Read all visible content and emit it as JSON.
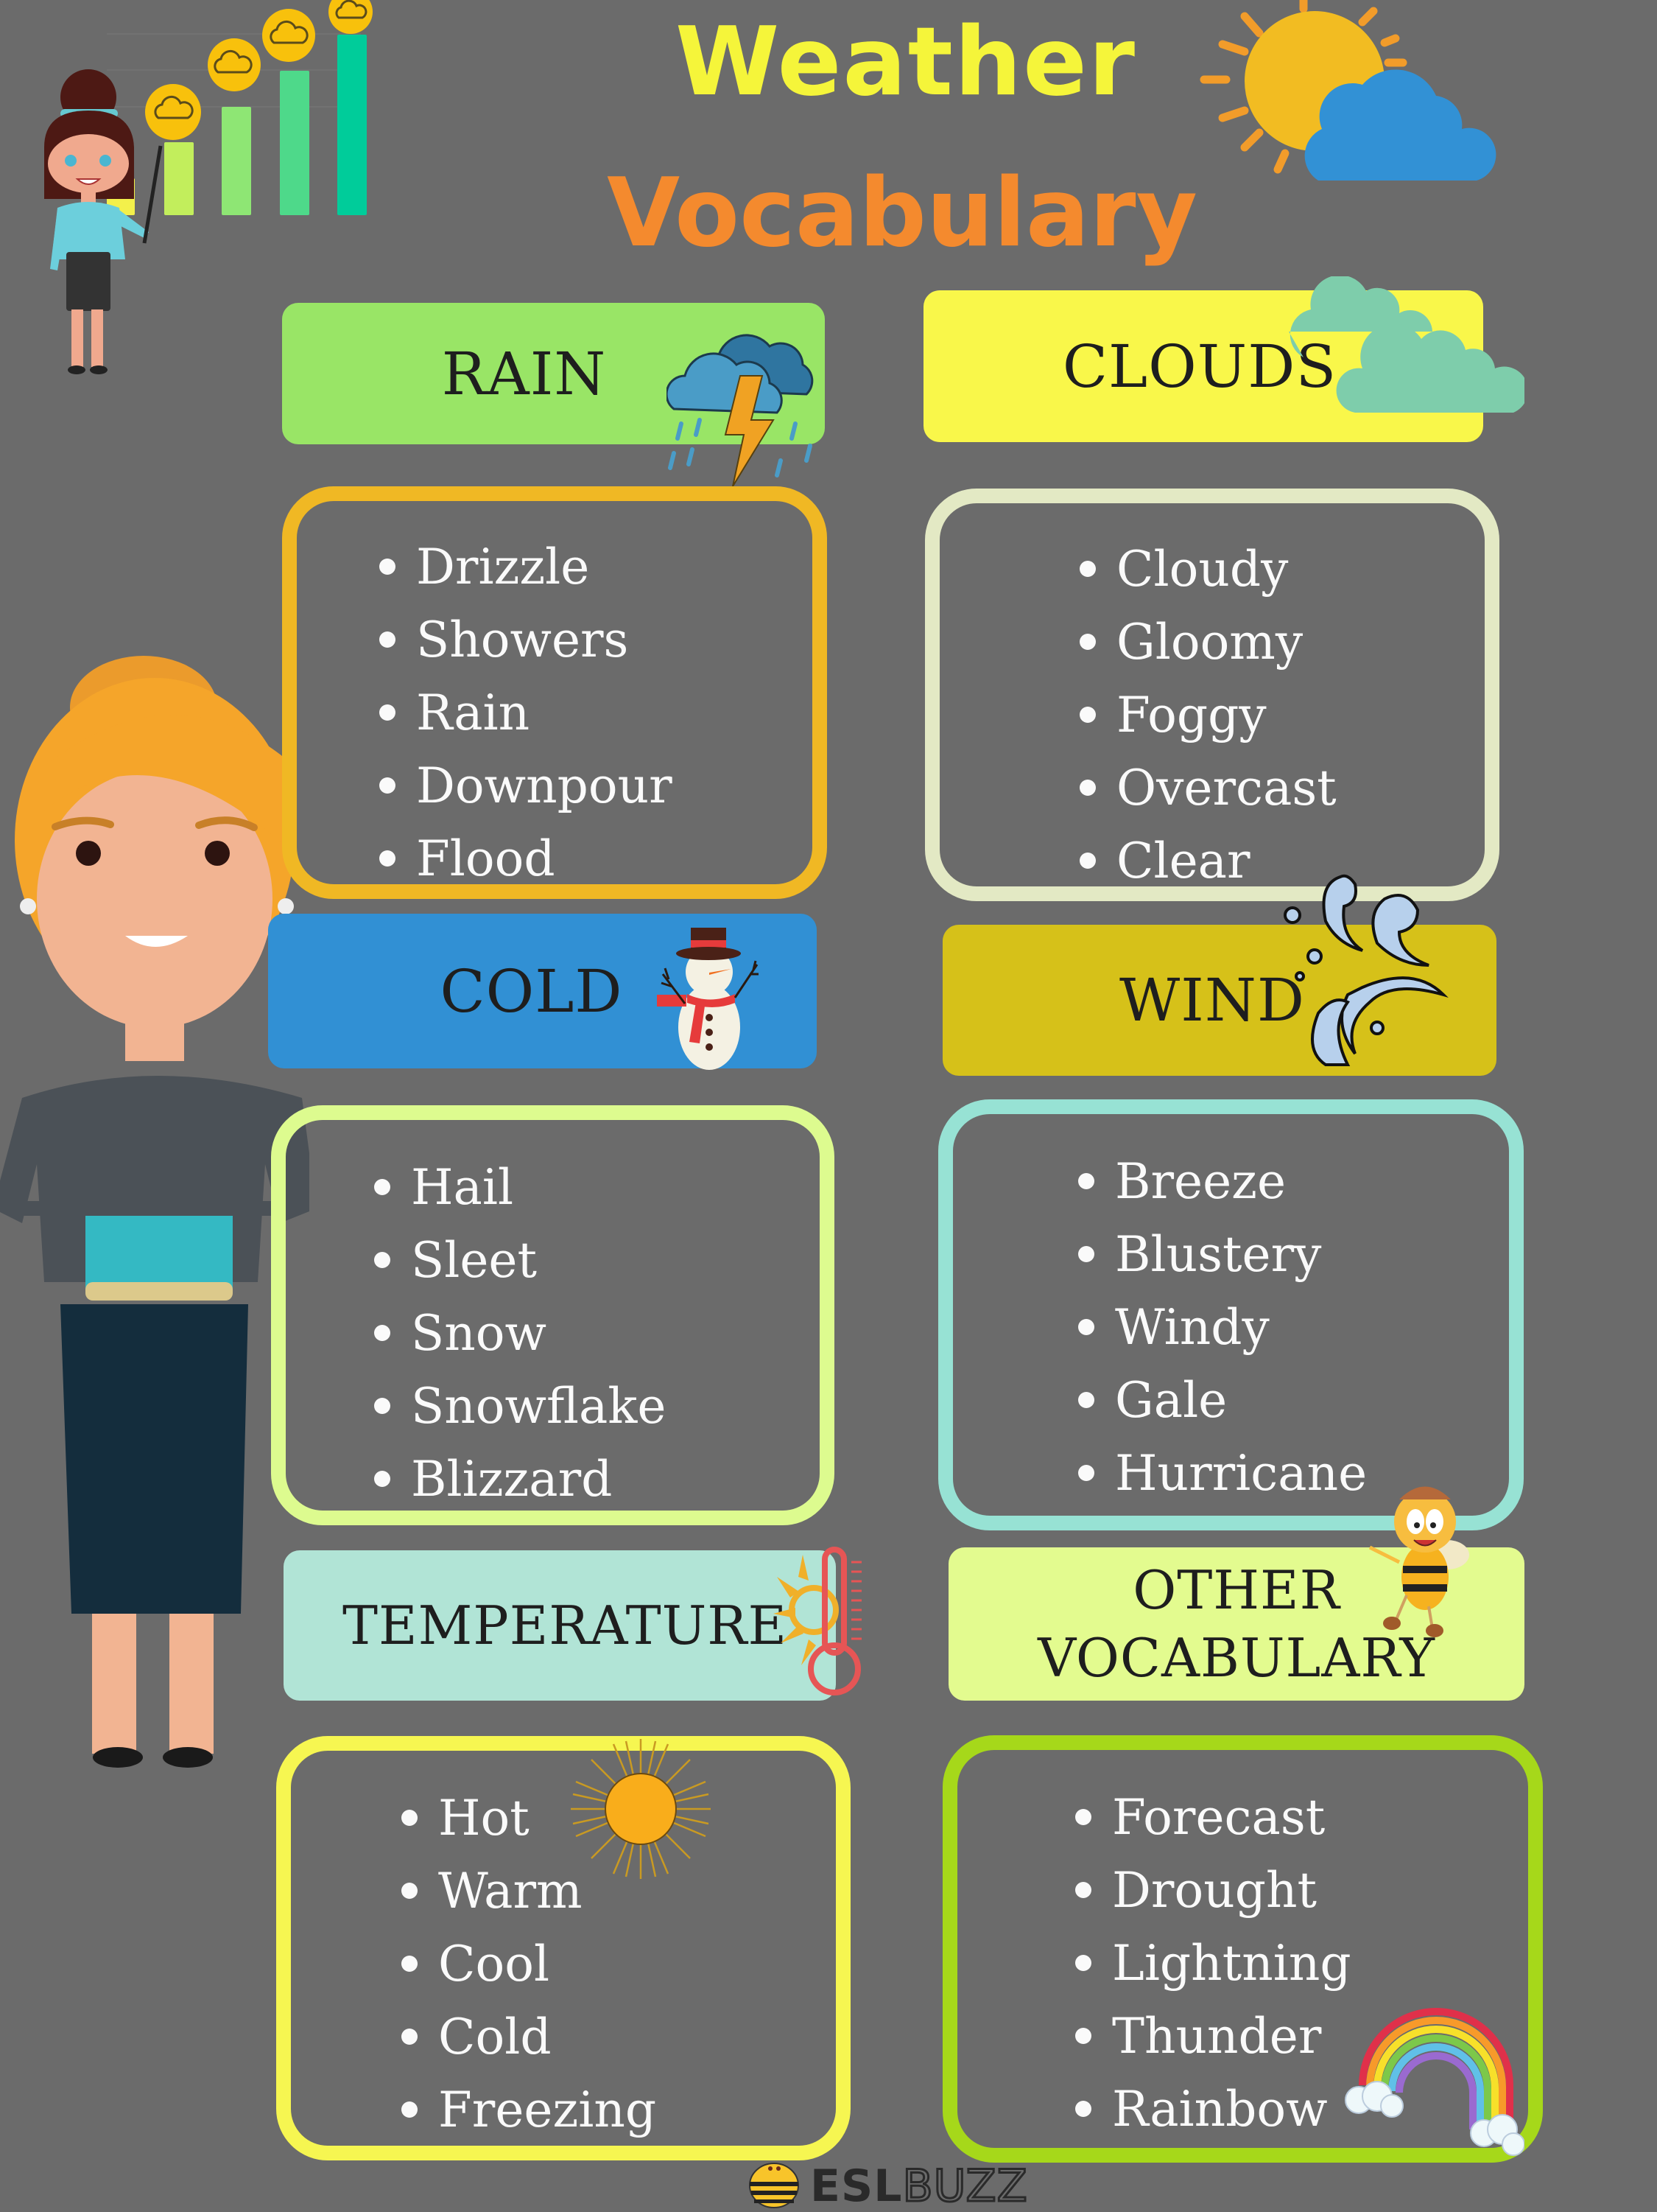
{
  "title": {
    "line1": "Weather",
    "line2": "Vocabulary"
  },
  "colors": {
    "background": "#6b6b6b",
    "title_line1": "#f5f53a",
    "title_line2": "#f48a2e"
  },
  "sections": [
    {
      "id": "rain",
      "heading": "RAIN",
      "heading_color": "#99e566",
      "border_color": "#f0b824",
      "icon": "storm-cloud-lightning-icon",
      "items": [
        "Drizzle",
        "Showers",
        "Rain",
        "Downpour",
        "Flood"
      ]
    },
    {
      "id": "clouds",
      "heading": "CLOUDS",
      "heading_color": "#f9f74a",
      "border_color": "#e3e9c4",
      "icon": "cloud-icon",
      "items": [
        "Cloudy",
        "Gloomy",
        "Foggy",
        "Overcast",
        "Clear"
      ]
    },
    {
      "id": "cold",
      "heading": "COLD",
      "heading_color": "#3190d4",
      "border_color": "#ddfb8f",
      "icon": "snowman-icon",
      "items": [
        "Hail",
        "Sleet",
        "Snow",
        "Snowflake",
        "Blizzard"
      ]
    },
    {
      "id": "wind",
      "heading": "WIND",
      "heading_color": "#d6c119",
      "border_color": "#97e2d4",
      "icon": "wind-gust-icon",
      "items": [
        "Breeze",
        "Blustery",
        "Windy",
        "Gale",
        "Hurricane"
      ]
    },
    {
      "id": "temperature",
      "heading": "TEMPERATURE",
      "heading_color": "#b1e4d6",
      "border_color": "#f6f651",
      "icon": "thermometer-sun-icon",
      "items": [
        "Hot",
        "Warm",
        "Cool",
        "Cold",
        "Freezing"
      ]
    },
    {
      "id": "other",
      "heading_line1": "OTHER",
      "heading_line2": "VOCABULARY",
      "heading_color": "#e3fb8f",
      "border_color": "#a6d81a",
      "icon": "bee-mascot-icon",
      "items": [
        "Forecast",
        "Drought",
        "Lightning",
        "Thunder",
        "Rainbow"
      ]
    }
  ],
  "decor": {
    "top_left": "teacher-with-bar-chart-illustration",
    "top_right": "sun-behind-cloud-icon",
    "left": "teacher-holding-book-illustration",
    "temperature_box": "sun-icon",
    "other_box": "rainbow-icon"
  },
  "footer": {
    "logo_bold": "ESL",
    "logo_outline": "BUZZ"
  }
}
